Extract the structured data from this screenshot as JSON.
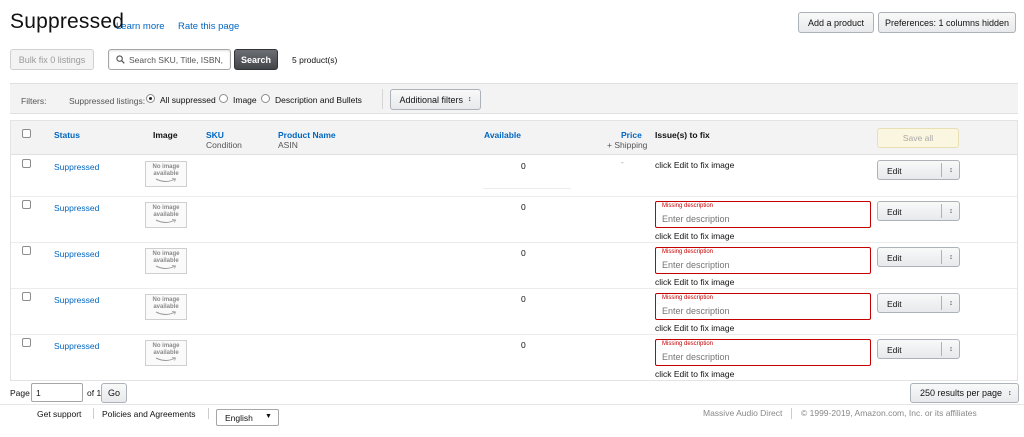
{
  "header": {
    "title": "Suppressed",
    "learn_more": "Learn more",
    "rate_page": "Rate this page",
    "add_product": "Add a product",
    "preferences": "Preferences: 1 columns hidden"
  },
  "toolbar": {
    "bulk_fix": "Bulk fix 0 listings",
    "search_placeholder": "Search SKU, Title, ISBN,",
    "search_button": "Search",
    "product_count": "5 product(s)"
  },
  "filters": {
    "label": "Filters:",
    "suppressed_label": "Suppressed listings:",
    "options": [
      {
        "label": "All suppressed",
        "selected": true
      },
      {
        "label": "Image",
        "selected": false
      },
      {
        "label": "Description and Bullets",
        "selected": false
      }
    ],
    "additional": "Additional filters"
  },
  "table": {
    "headers": {
      "status": "Status",
      "image": "Image",
      "sku": "SKU",
      "condition": "Condition",
      "product_name": "Product Name",
      "asin": "ASIN",
      "available": "Available",
      "price": "Price",
      "shipping": "+ Shipping",
      "issues": "Issue(s) to fix",
      "save_all": "Save all"
    },
    "rows": [
      {
        "status": "Suppressed",
        "image_line1": "No image",
        "image_line2": "available",
        "available": "0",
        "price": "-",
        "has_desc": false,
        "desc_label": "",
        "desc_placeholder": "",
        "issue": "click Edit to fix image",
        "action": "Edit"
      },
      {
        "status": "Suppressed",
        "image_line1": "No image",
        "image_line2": "available",
        "available": "0",
        "price": "",
        "has_desc": true,
        "desc_label": "Missing description",
        "desc_placeholder": "Enter description",
        "issue": "click Edit to fix image",
        "action": "Edit"
      },
      {
        "status": "Suppressed",
        "image_line1": "No image",
        "image_line2": "available",
        "available": "0",
        "price": "",
        "has_desc": true,
        "desc_label": "Missing description",
        "desc_placeholder": "Enter description",
        "issue": "click Edit to fix image",
        "action": "Edit"
      },
      {
        "status": "Suppressed",
        "image_line1": "No image",
        "image_line2": "available",
        "available": "0",
        "price": "",
        "has_desc": true,
        "desc_label": "Missing description",
        "desc_placeholder": "Enter description",
        "issue": "click Edit to fix image",
        "action": "Edit"
      },
      {
        "status": "Suppressed",
        "image_line1": "No image",
        "image_line2": "available",
        "available": "0",
        "price": "",
        "has_desc": true,
        "desc_label": "Missing description",
        "desc_placeholder": "Enter description",
        "issue": "click Edit to fix image",
        "action": "Edit"
      }
    ]
  },
  "pager": {
    "page_label": "Page",
    "page_value": "1",
    "of_label": "of 1",
    "go": "Go",
    "results_per_page": "250 results per page"
  },
  "footer": {
    "get_support": "Get support",
    "policies": "Policies and Agreements",
    "language": "English",
    "seller": "Massive Audio Direct",
    "copyright": "© 1999-2019, Amazon.com, Inc. or its affiliates"
  },
  "icons": {
    "search": "search-icon",
    "dropdown": "chevron-updown-icon",
    "language_arrow": "caret-down-icon"
  },
  "colors": {
    "link": "#0066c0",
    "error": "#c40000",
    "search_button": "#424649",
    "save_all_bg": "#fbf6e0"
  }
}
